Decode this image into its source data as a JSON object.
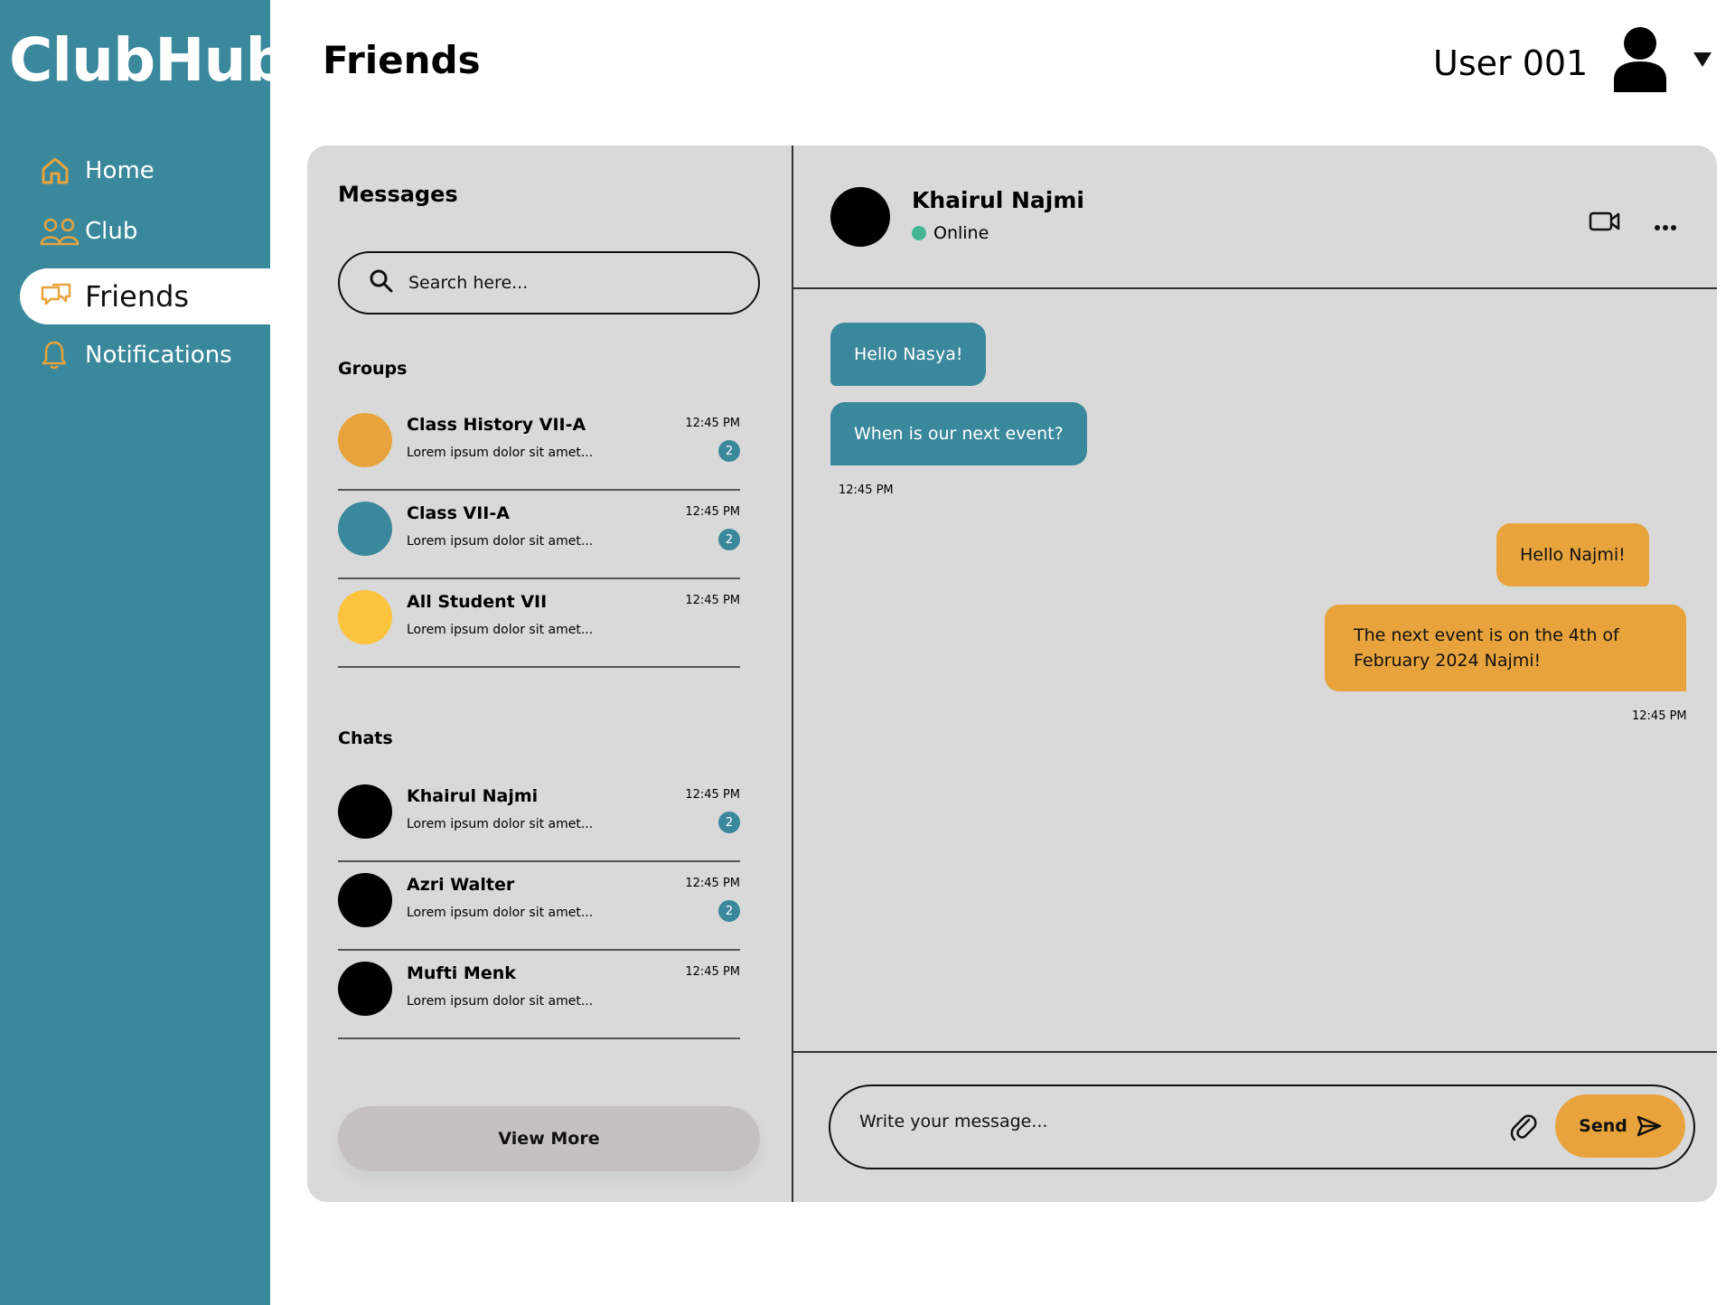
{
  "app": {
    "name": "ClubHub"
  },
  "sidebar": {
    "items": [
      {
        "label": "Home",
        "icon": "home-icon"
      },
      {
        "label": "Club",
        "icon": "users-icon"
      },
      {
        "label": "Friends",
        "icon": "chat-bubbles-icon",
        "active": true
      },
      {
        "label": "Notifications",
        "icon": "bell-icon"
      }
    ]
  },
  "header": {
    "title": "Friends",
    "user_name": "User 001"
  },
  "messages": {
    "title": "Messages",
    "search_placeholder": "Search here...",
    "groups_label": "Groups",
    "groups": [
      {
        "name": "Class History VII-A",
        "preview": "Lorem ipsum dolor sit amet...",
        "time": "12:45 PM",
        "badge": "2",
        "color": "#e8a33c"
      },
      {
        "name": "Class VII-A",
        "preview": "Lorem ipsum dolor sit amet...",
        "time": "12:45 PM",
        "badge": "2",
        "color": "#3a889c"
      },
      {
        "name": "All Student VII",
        "preview": "Lorem ipsum dolor sit amet...",
        "time": "12:45 PM",
        "badge": "",
        "color": "#fcc43c"
      }
    ],
    "chats_label": "Chats",
    "chats": [
      {
        "name": "Khairul Najmi",
        "preview": "Lorem ipsum dolor sit amet...",
        "time": "12:45 PM",
        "badge": "2"
      },
      {
        "name": "Azri Walter",
        "preview": "Lorem ipsum dolor sit amet...",
        "time": "12:45 PM",
        "badge": "2"
      },
      {
        "name": "Mufti Menk",
        "preview": "Lorem ipsum dolor sit amet...",
        "time": "12:45 PM",
        "badge": ""
      }
    ],
    "view_more_label": "View More"
  },
  "conversation": {
    "contact_name": "Khairul Najmi",
    "status": "Online",
    "incoming": [
      "Hello Nasya!",
      "When is our next event?"
    ],
    "incoming_time": "12:45 PM",
    "outgoing": [
      "Hello Najmi!",
      "The next event is on the 4th of February 2024 Najmi!"
    ],
    "outgoing_time": "12:45 PM",
    "composer_placeholder": "Write your message...",
    "send_label": "Send"
  },
  "colors": {
    "teal": "#3a889c",
    "orange": "#e8a33c",
    "yellow": "#fcc43c",
    "panel": "#d9d9d9",
    "online": "#43b592"
  }
}
